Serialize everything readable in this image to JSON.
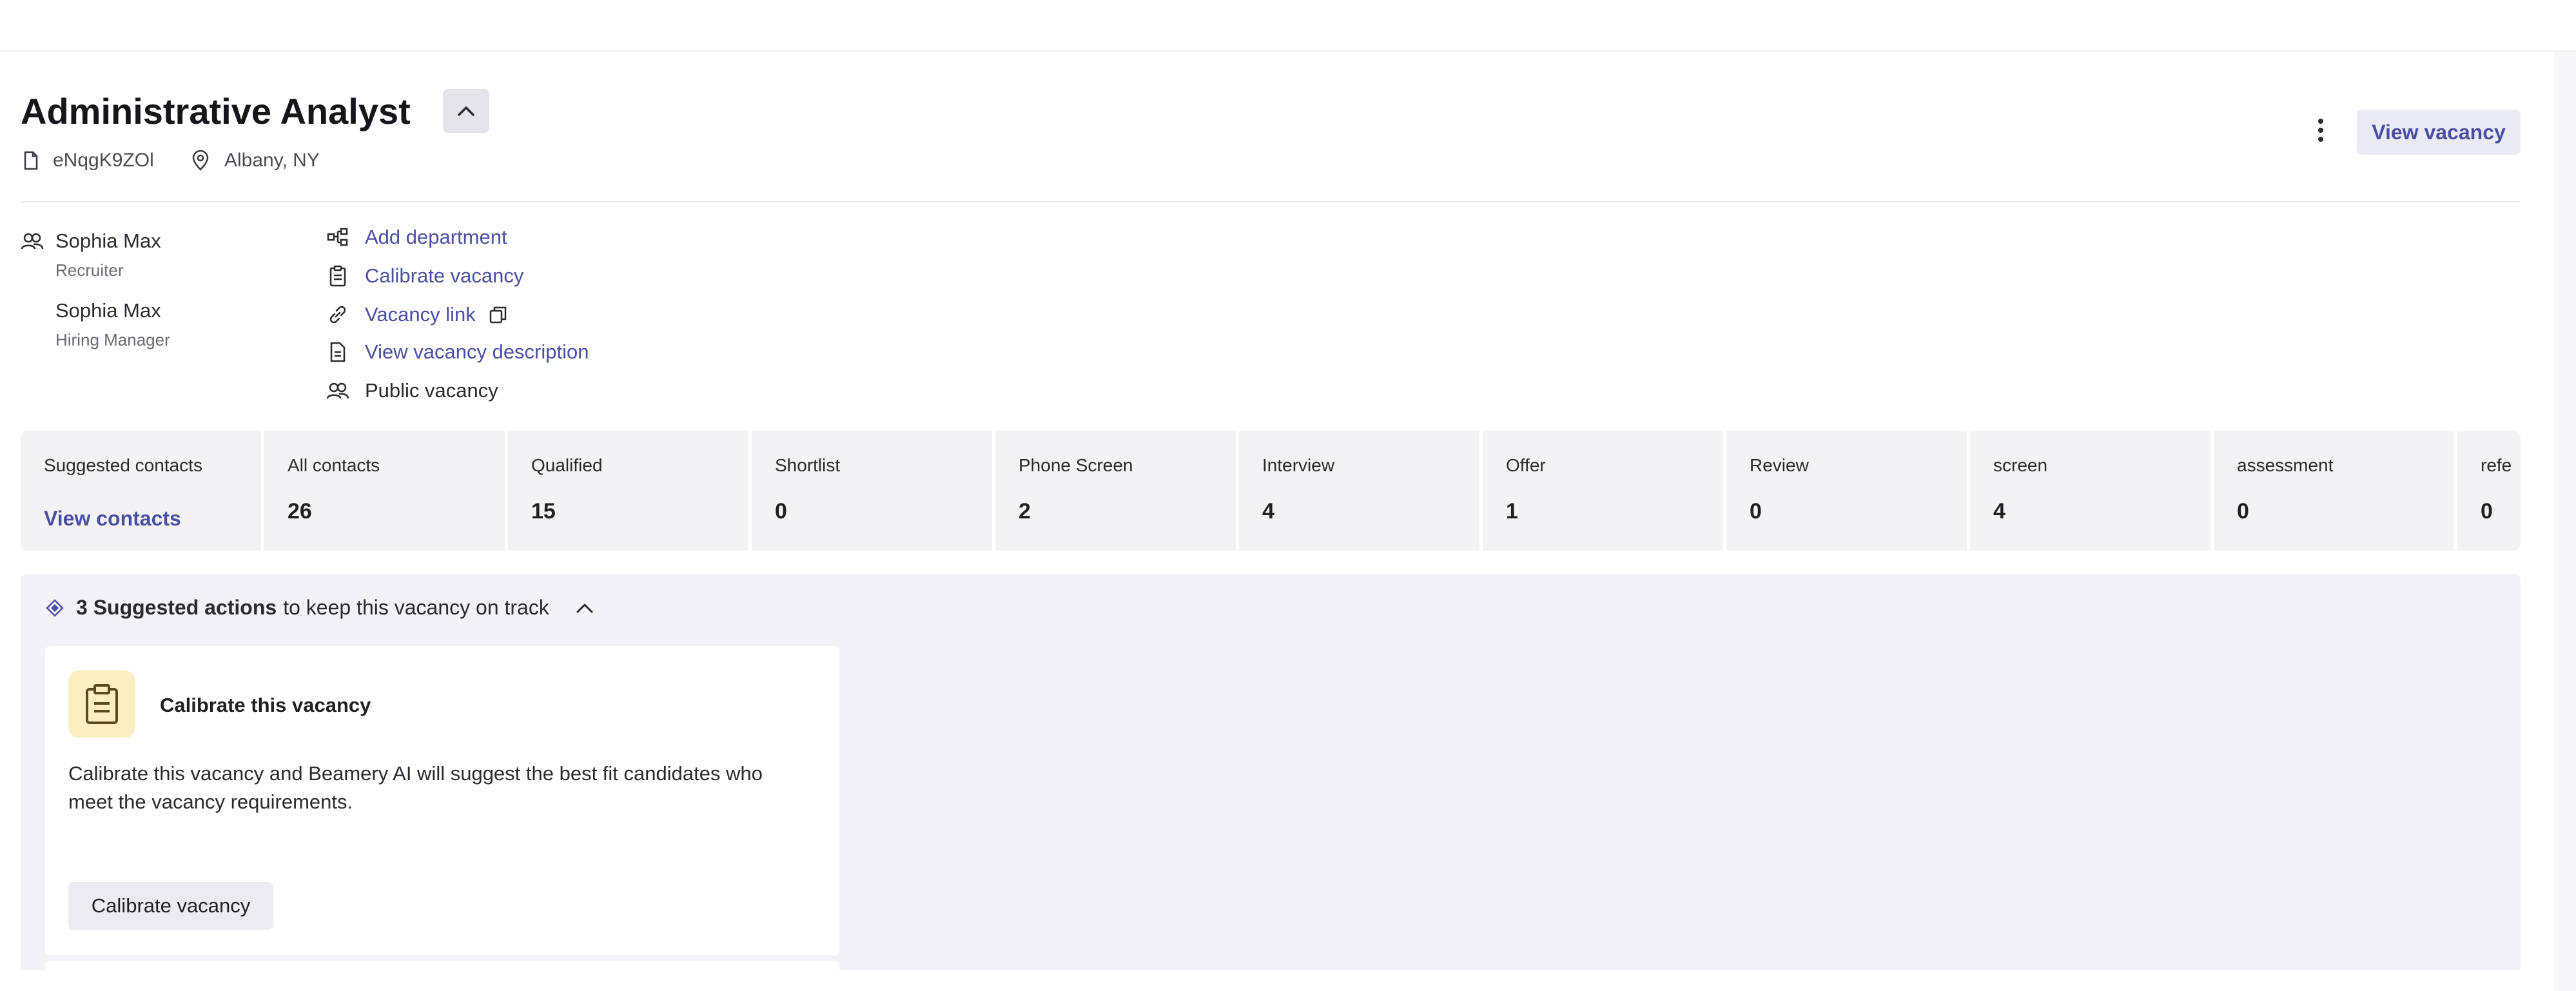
{
  "vacancy": {
    "title": "Administrative Analyst",
    "id": "eNqgK9ZOl",
    "location": "Albany, NY"
  },
  "header": {
    "view_vacancy_label": "View vacancy"
  },
  "team": [
    {
      "name": "Sophia Max",
      "role": "Recruiter"
    },
    {
      "name": "Sophia Max",
      "role": "Hiring Manager"
    }
  ],
  "links": {
    "add_department": "Add department",
    "calibrate_vacancy": "Calibrate vacancy",
    "vacancy_link": "Vacancy link",
    "view_description": "View vacancy description",
    "public_vacancy": "Public vacancy"
  },
  "pipeline": {
    "suggested_label": "Suggested contacts",
    "suggested_link": "View contacts",
    "stages": [
      {
        "label": "All contacts",
        "count": "26"
      },
      {
        "label": "Qualified",
        "count": "15"
      },
      {
        "label": "Shortlist",
        "count": "0"
      },
      {
        "label": "Phone Screen",
        "count": "2"
      },
      {
        "label": "Interview",
        "count": "4"
      },
      {
        "label": "Offer",
        "count": "1"
      },
      {
        "label": "Review",
        "count": "0"
      },
      {
        "label": "screen",
        "count": "4"
      },
      {
        "label": "assessment",
        "count": "0"
      },
      {
        "label": "refe",
        "count": "0"
      }
    ]
  },
  "suggested_actions": {
    "count_label": "3 Suggested actions",
    "suffix": "to keep this vacancy on track",
    "card": {
      "title": "Calibrate this vacancy",
      "description": "Calibrate this vacancy and Beamery AI will suggest the best fit candidates who meet the vacancy requirements.",
      "button": "Calibrate vacancy"
    }
  },
  "colors": {
    "accent": "#4a4fa3",
    "panel": "#f3f3f6",
    "icon_bg": "#fbefc2"
  }
}
